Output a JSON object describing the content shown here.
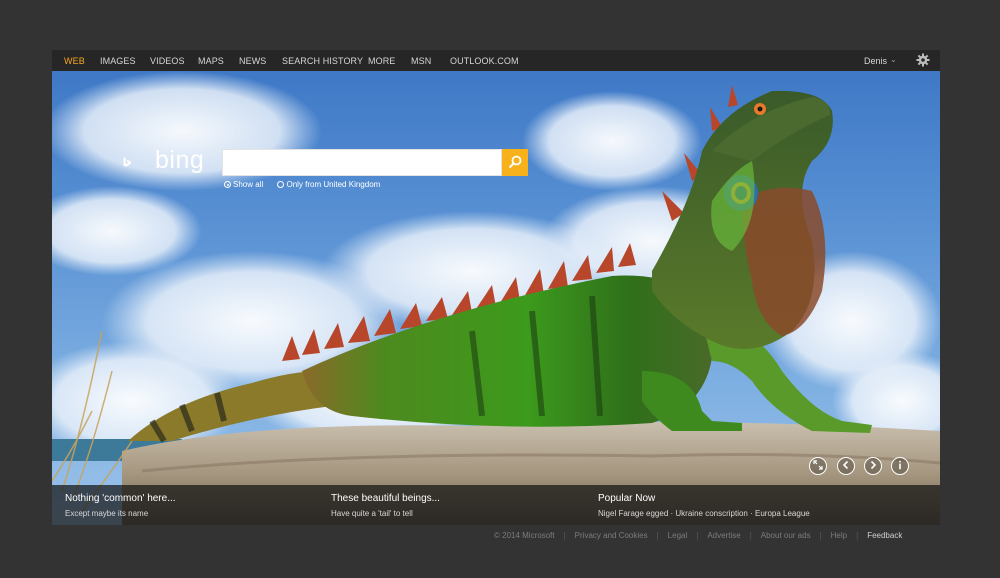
{
  "nav": {
    "items": [
      {
        "label": "WEB",
        "active": true
      },
      {
        "label": "IMAGES"
      },
      {
        "label": "VIDEOS"
      },
      {
        "label": "MAPS"
      },
      {
        "label": "NEWS"
      },
      {
        "label": "SEARCH HISTORY"
      },
      {
        "label": "MORE"
      },
      {
        "label": "MSN"
      },
      {
        "label": "OUTLOOK.COM"
      }
    ],
    "user_name": "Denis",
    "user_caret": "⌄",
    "settings_icon": "gear-icon"
  },
  "logo": {
    "text": "bing"
  },
  "search": {
    "value": "",
    "button_icon": "search-icon",
    "options": [
      {
        "label": "Show all",
        "checked": true
      },
      {
        "label": "Only from United Kingdom",
        "checked": false
      }
    ]
  },
  "controls": {
    "fullscreen_icon": "expand-icon",
    "prev_icon": "chevron-left-icon",
    "next_icon": "chevron-right-icon",
    "info_icon": "info-icon"
  },
  "info": [
    {
      "title": "Nothing 'common' here...",
      "sub": [
        "Except maybe its name"
      ]
    },
    {
      "title": "These beautiful beings...",
      "sub": [
        "Have quite a 'tail' to tell"
      ]
    },
    {
      "title": "Popular Now",
      "sub": [
        "Nigel Farage egged",
        "Ukraine conscription",
        "Europa League"
      ]
    }
  ],
  "footer": {
    "copyright": "© 2014 Microsoft",
    "links": [
      "Privacy and Cookies",
      "Legal",
      "Advertise",
      "About our ads",
      "Help"
    ],
    "feedback": "Feedback"
  },
  "colors": {
    "accent": "#f5a623",
    "search_button": "#f7b21b",
    "page_bg": "#333333"
  }
}
